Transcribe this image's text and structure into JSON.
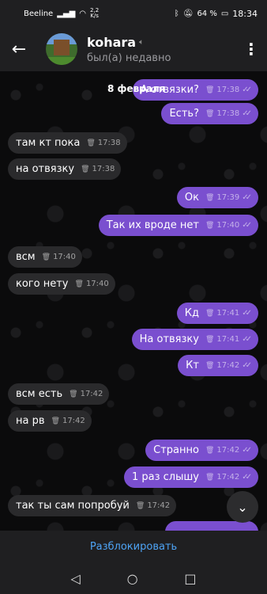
{
  "status_bar": {
    "carrier": "Beeline",
    "net_speed_value": "2,2",
    "net_speed_unit": "K/s",
    "battery": "64 %",
    "time": "18:34"
  },
  "header": {
    "back_icon": "arrow-left-icon",
    "name": "kohara",
    "status": "был(а) недавно",
    "menu_icon": "more-vertical-icon"
  },
  "chat": {
    "date_label": "8 февраля",
    "messages": [
      {
        "dir": "out",
        "text": "А отвязки?",
        "time": "17:38"
      },
      {
        "dir": "out",
        "text": "Есть?",
        "time": "17:38"
      },
      {
        "dir": "in",
        "text": "там кт пока",
        "time": "17:38"
      },
      {
        "dir": "in",
        "text": "на отвязку",
        "time": "17:38"
      },
      {
        "dir": "out",
        "text": "Ок",
        "time": "17:39"
      },
      {
        "dir": "out",
        "text": "Так их вроде нет",
        "time": "17:40"
      },
      {
        "dir": "in",
        "text": "всм",
        "time": "17:40"
      },
      {
        "dir": "in",
        "text": "кого нету",
        "time": "17:40"
      },
      {
        "dir": "out",
        "text": "Кд",
        "time": "17:41"
      },
      {
        "dir": "out",
        "text": "На отвязку",
        "time": "17:41"
      },
      {
        "dir": "out",
        "text": "Кт",
        "time": "17:42"
      },
      {
        "dir": "in",
        "text": "всм есть",
        "time": "17:42"
      },
      {
        "dir": "in",
        "text": "на рв",
        "time": "17:42"
      },
      {
        "dir": "out",
        "text": "Странно",
        "time": "17:42"
      },
      {
        "dir": "out",
        "text": "1 раз слышу",
        "time": "17:42"
      },
      {
        "dir": "in",
        "text": "так ты сам попробуй",
        "time": "17:42"
      }
    ]
  },
  "footer": {
    "unblock_label": "Разблокировать"
  },
  "colors": {
    "outgoing_bubble": "#7a4fcf",
    "incoming_bubble": "#2a2a2c",
    "accent": "#4ea4f6"
  }
}
